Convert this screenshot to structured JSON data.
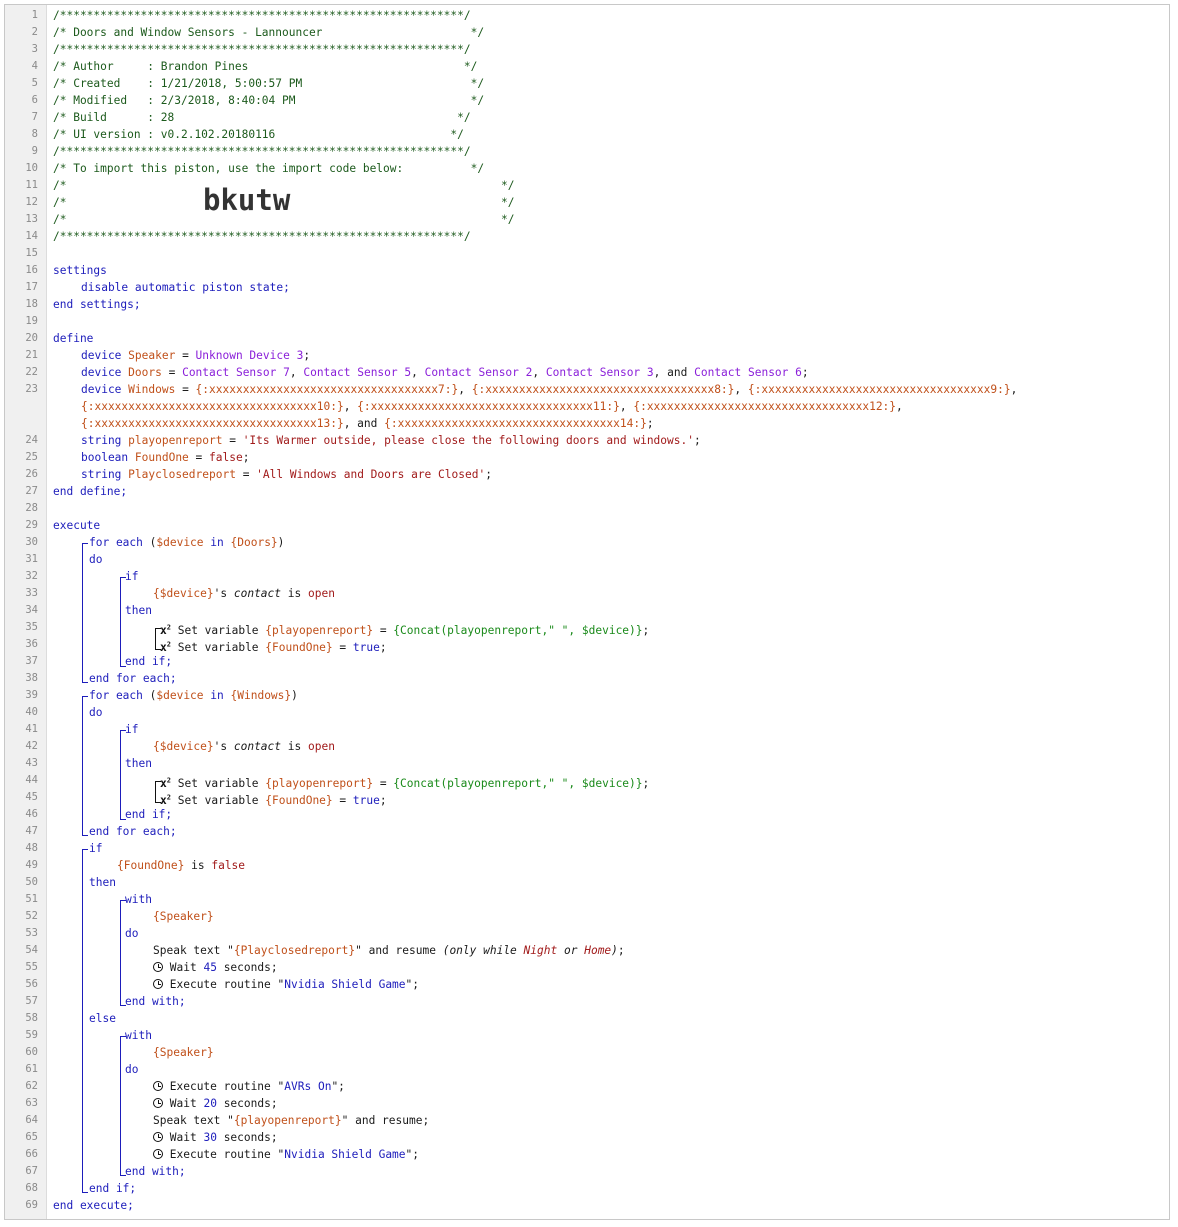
{
  "editor": {
    "header": {
      "border_line": "/************************************************************/",
      "title": "/* Doors and Window Sensors - Lannouncer                      */",
      "author": "/* Author     : Brandon Pines                                */",
      "created": "/* Created    : 1/21/2018, 5:00:57 PM                         */",
      "modified": "/* Modified   : 2/3/2018, 8:40:04 PM                          */",
      "build": "/* Build      : 28                                          */",
      "ui_version": "/* UI version : v0.2.102.20180116                          */",
      "import_text": "/* To import this piston, use the import code below:          */",
      "blank_open": "/*",
      "blank_close": "*/",
      "import_code": "bkutw"
    },
    "settings": {
      "open": "settings",
      "item": "disable automatic piston state;",
      "close": "end settings;"
    },
    "define": {
      "open": "define",
      "close": "end define;",
      "speaker": {
        "type": "device",
        "name": "Speaker",
        "eq": " = ",
        "value": "Unknown Device 3",
        "end": ";"
      },
      "doors": {
        "type": "device",
        "name": "Doors",
        "eq": " = ",
        "items": [
          "Contact Sensor 7",
          "Contact Sensor 5",
          "Contact Sensor 2",
          "Contact Sensor 3"
        ],
        "and": "and",
        "last": "Contact Sensor 6"
      },
      "windows": {
        "type": "device",
        "name": "Windows",
        "eq": " = ",
        "ids": [
          "{:xxxxxxxxxxxxxxxxxxxxxxxxxxxxxxxxxx7:}",
          "{:xxxxxxxxxxxxxxxxxxxxxxxxxxxxxxxxxx8:}",
          "{:xxxxxxxxxxxxxxxxxxxxxxxxxxxxxxxxxx9:}",
          "{:xxxxxxxxxxxxxxxxxxxxxxxxxxxxxxxxx10:}",
          "{:xxxxxxxxxxxxxxxxxxxxxxxxxxxxxxxxx11:}",
          "{:xxxxxxxxxxxxxxxxxxxxxxxxxxxxxxxxx12:}",
          "{:xxxxxxxxxxxxxxxxxxxxxxxxxxxxxxxxx13:}",
          "{:xxxxxxxxxxxxxxxxxxxxxxxxxxxxxxxxx14:}"
        ],
        "and": "and"
      },
      "playopenreport": {
        "type": "string",
        "name": "playopenreport",
        "eq": " = ",
        "value": "'Its Warmer outside, please close the following doors and windows.'"
      },
      "foundone": {
        "type": "boolean",
        "name": "FoundOne",
        "eq": " = ",
        "value": "false"
      },
      "playclosedreport": {
        "type": "string",
        "name": "Playclosedreport",
        "eq": " = ",
        "value": "'All Windows and Doors are Closed'"
      }
    },
    "execute": {
      "open": "execute",
      "close": "end execute;",
      "for_each": "for each",
      "device_var": "$device",
      "in": "in",
      "doors_ref": "{Doors}",
      "windows_ref": "{Windows}",
      "do": "do",
      "if": "if",
      "then": "then",
      "else": "else",
      "end_if": "end if;",
      "end_for_each": "end for each;",
      "with": "with",
      "end_with": "end with;",
      "device_ref": "{$device}",
      "possessive": "'s",
      "contact": "contact",
      "is": "is",
      "open_val": "open",
      "false_val": "false",
      "set_variable": "Set variable",
      "playopenreport_ref": "{playopenreport}",
      "concat_expr": "{Concat(playopenreport,\" \", $device)}",
      "foundone_ref": "{FoundOne}",
      "true_val": "true",
      "speaker_ref": "{Speaker}",
      "speak_text": "Speak text",
      "playclosedreport_ref": "{Playclosedreport}",
      "and_resume": "and resume",
      "only_while": "only while",
      "night": "Night",
      "or": "or",
      "home": "Home",
      "wait": "Wait",
      "seconds": "seconds;",
      "wait_45": "45",
      "wait_20": "20",
      "wait_30": "30",
      "execute_routine": "Execute routine",
      "routine_shield": "Nvidia Shield Game",
      "routine_avrs": "AVRs On",
      "x2": "x"
    }
  },
  "line_numbers": [
    "1",
    "2",
    "3",
    "4",
    "5",
    "6",
    "7",
    "8",
    "9",
    "10",
    "11",
    "12",
    "13",
    "14",
    "15",
    "16",
    "17",
    "18",
    "19",
    "20",
    "21",
    "22",
    "23",
    "24",
    "25",
    "26",
    "27",
    "28",
    "29",
    "30",
    "31",
    "32",
    "33",
    "34",
    "35",
    "36",
    "37",
    "38",
    "39",
    "40",
    "41",
    "42",
    "43",
    "44",
    "45",
    "46",
    "47",
    "48",
    "49",
    "50",
    "51",
    "52",
    "53",
    "54",
    "55",
    "56",
    "57",
    "58",
    "59",
    "60",
    "61",
    "62",
    "63",
    "64",
    "65",
    "66",
    "67",
    "68",
    "69"
  ]
}
